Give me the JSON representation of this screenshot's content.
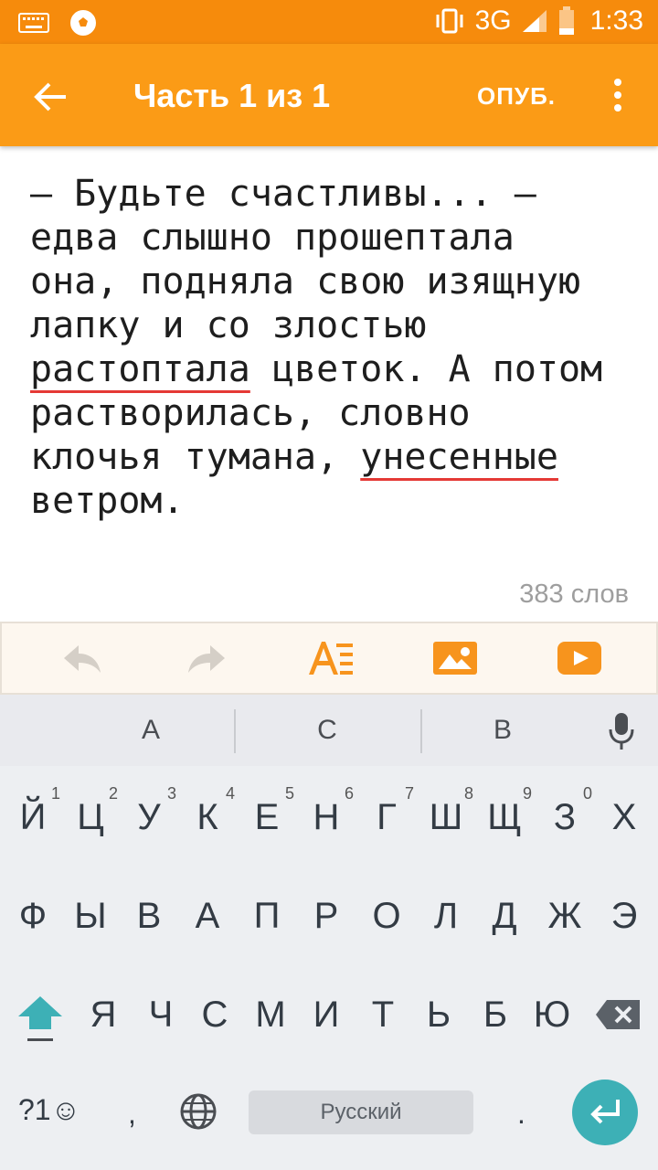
{
  "status_bar": {
    "network": "3G",
    "time": "1:33",
    "icons": [
      "keyboard-icon",
      "soccer-ball-icon",
      "vibrate-icon",
      "signal-icon",
      "battery-icon"
    ]
  },
  "app_bar": {
    "title": "Часть 1 из 1",
    "publish_label": "ОПУБ.",
    "icons": [
      "back-arrow-icon",
      "more-vert-icon"
    ],
    "background_color": "#fb9b16"
  },
  "editor": {
    "lines": [
      "– Будьте счастливы... –",
      "едва слышно прошептала",
      "она, подняла свою изящную",
      "лапку и со злостью",
      "растоптала цветок. А потом",
      "растворилась, словно",
      "клочья тумана, унесенные",
      "ветром."
    ],
    "misspelled_words": [
      "растоптала",
      "унесенные"
    ],
    "word_count": "383 слов"
  },
  "toolbar": {
    "icons": [
      "undo-icon",
      "redo-icon",
      "text-format-icon",
      "image-icon",
      "video-icon"
    ],
    "accent_color": "#f7941d"
  },
  "suggestions": [
    "А",
    "С",
    "В"
  ],
  "keyboard": {
    "row1": [
      "Й",
      "Ц",
      "У",
      "К",
      "Е",
      "Н",
      "Г",
      "Ш",
      "Щ",
      "З",
      "Х"
    ],
    "row1_hints": [
      "1",
      "2",
      "3",
      "4",
      "5",
      "6",
      "7",
      "8",
      "9",
      "0",
      ""
    ],
    "row2": [
      "Ф",
      "Ы",
      "В",
      "А",
      "П",
      "Р",
      "О",
      "Л",
      "Д",
      "Ж",
      "Э"
    ],
    "row3": [
      "Я",
      "Ч",
      "С",
      "М",
      "И",
      "Т",
      "Ь",
      "Б",
      "Ю"
    ],
    "symbols_label": "?1☺",
    "comma": ",",
    "period": ".",
    "space_label": "Русский",
    "enter_color": "#3db0b6"
  }
}
